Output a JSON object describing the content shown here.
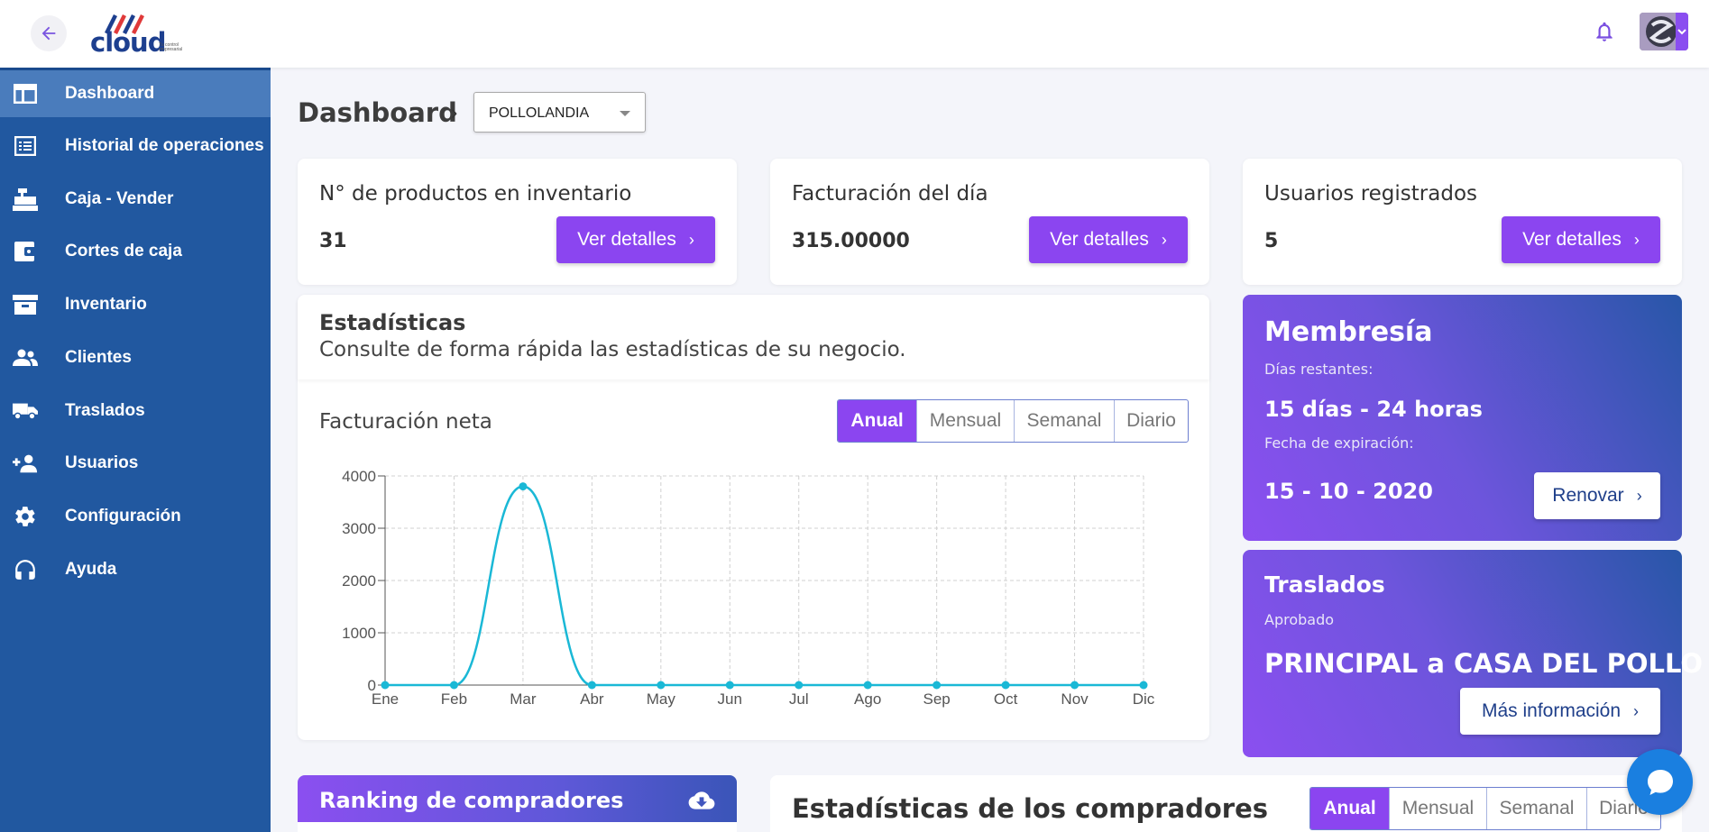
{
  "brand": {
    "logo_text": "cloud",
    "tagline": "Tu control empresarial"
  },
  "sidebar": {
    "items": [
      {
        "label": "Dashboard",
        "icon": "dashboard-icon"
      },
      {
        "label": "Historial de operaciones",
        "icon": "list-icon"
      },
      {
        "label": "Caja - Vender",
        "icon": "cash-register-icon"
      },
      {
        "label": "Cortes de caja",
        "icon": "wallet-icon"
      },
      {
        "label": "Inventario",
        "icon": "archive-icon"
      },
      {
        "label": "Clientes",
        "icon": "people-icon"
      },
      {
        "label": "Traslados",
        "icon": "truck-icon"
      },
      {
        "label": "Usuarios",
        "icon": "person-add-icon"
      },
      {
        "label": "Configuración",
        "icon": "gear-icon"
      },
      {
        "label": "Ayuda",
        "icon": "headset-icon"
      }
    ],
    "active_index": 0
  },
  "header": {
    "title": "Dashboard",
    "store_select": "POLLOLANDIA"
  },
  "cards": [
    {
      "title": "N° de productos en inventario",
      "value": "31",
      "button": "Ver detalles"
    },
    {
      "title": "Facturación del día",
      "value": "315.00000",
      "button": "Ver detalles"
    },
    {
      "title": "Usuarios registrados",
      "value": "5",
      "button": "Ver detalles"
    }
  ],
  "stats": {
    "title": "Estadísticas",
    "subtitle": "Consulte de forma rápida las estadísticas de su negocio.",
    "chart_title": "Facturación neta",
    "periods": [
      "Anual",
      "Mensual",
      "Semanal",
      "Diario"
    ],
    "active_period": "Anual"
  },
  "membership": {
    "title": "Membresía",
    "remaining_label": "Días restantes:",
    "remaining_value": "15 días - 24 horas",
    "expiry_label": "Fecha de expiración:",
    "expiry_value": "15 - 10 - 2020",
    "button": "Renovar"
  },
  "transfers": {
    "title": "Traslados",
    "status": "Aprobado",
    "route": "PRINCIPAL a CASA DEL POLLO",
    "button": "Más información"
  },
  "ranking": {
    "title": "Ranking de compradores"
  },
  "buyers": {
    "title": "Estadísticas de los compradores",
    "periods": [
      "Anual",
      "Mensual",
      "Semanal",
      "Diario"
    ]
  },
  "colors": {
    "accent": "#8b45f0",
    "sidebar": "#2158a0",
    "line": "#1ab8d6"
  },
  "chart_data": {
    "type": "line",
    "categories": [
      "Ene",
      "Feb",
      "Mar",
      "Abr",
      "May",
      "Jun",
      "Jul",
      "Ago",
      "Sep",
      "Oct",
      "Nov",
      "Dic"
    ],
    "values": [
      0,
      0,
      3800,
      0,
      0,
      0,
      0,
      0,
      0,
      0,
      0,
      0
    ],
    "yticks": [
      0,
      1000,
      2000,
      3000,
      4000
    ],
    "ylim": [
      0,
      4000
    ],
    "grid": true
  }
}
